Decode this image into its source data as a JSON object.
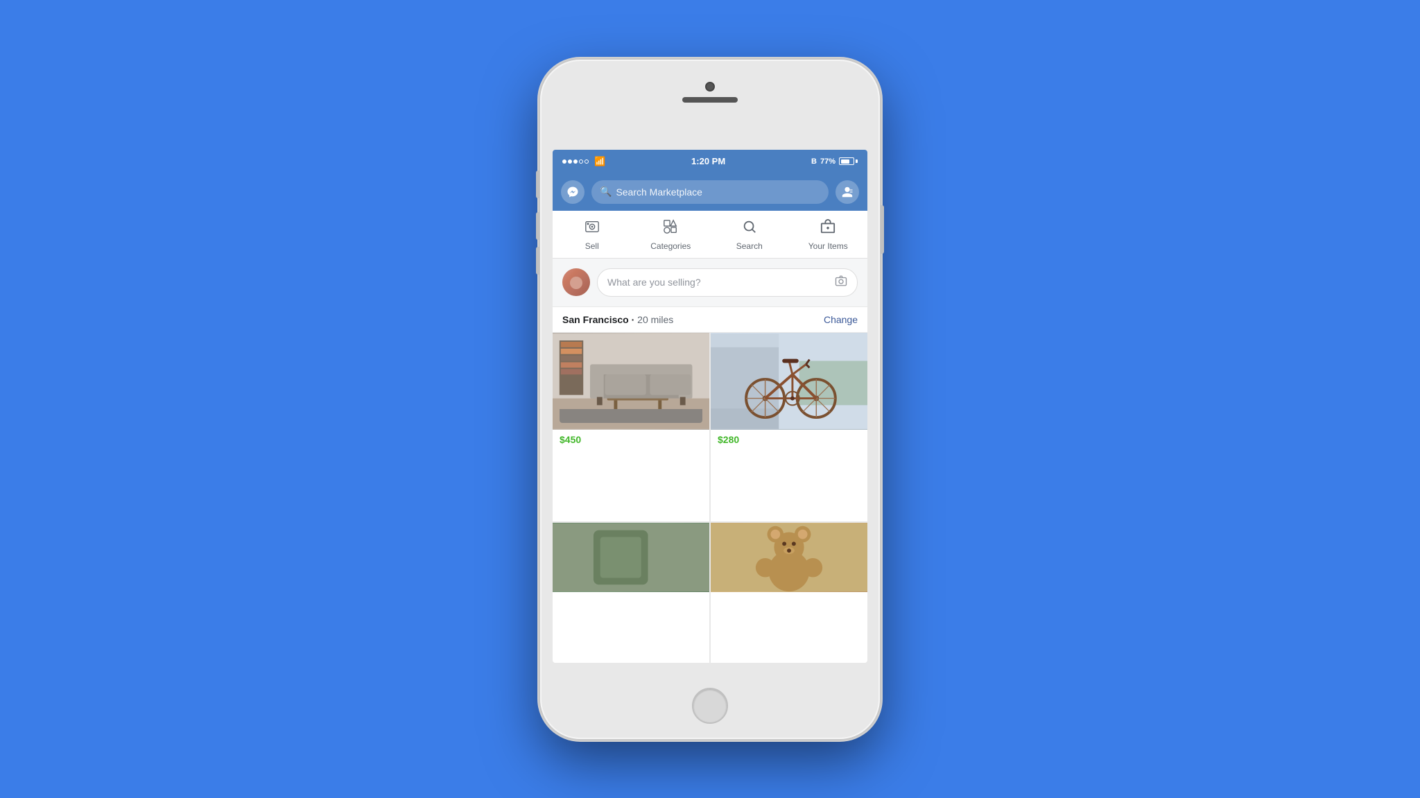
{
  "background_color": "#3b7de8",
  "status_bar": {
    "time": "1:20 PM",
    "signal_dots": [
      "full",
      "full",
      "full",
      "empty",
      "empty"
    ],
    "wifi": "wifi",
    "bluetooth": "B",
    "battery_percent": "77%"
  },
  "header": {
    "search_placeholder": "Search Marketplace",
    "messenger_icon": "💬",
    "profile_icon": "👤"
  },
  "nav_tabs": [
    {
      "id": "sell",
      "label": "Sell",
      "icon": "📷"
    },
    {
      "id": "categories",
      "label": "Categories",
      "icon": "⭐"
    },
    {
      "id": "search",
      "label": "Search",
      "icon": "🔍"
    },
    {
      "id": "your-items",
      "label": "Your Items",
      "icon": "📦"
    }
  ],
  "sell_area": {
    "placeholder": "What are you selling?"
  },
  "location": {
    "city": "San Francisco",
    "distance": "20 miles",
    "change_label": "Change"
  },
  "products": [
    {
      "id": "sofa",
      "price": "$450",
      "type": "sofa"
    },
    {
      "id": "bike",
      "price": "$280",
      "type": "bike"
    },
    {
      "id": "plant",
      "price": "",
      "type": "green"
    },
    {
      "id": "teddy",
      "price": "",
      "type": "teddy"
    }
  ]
}
